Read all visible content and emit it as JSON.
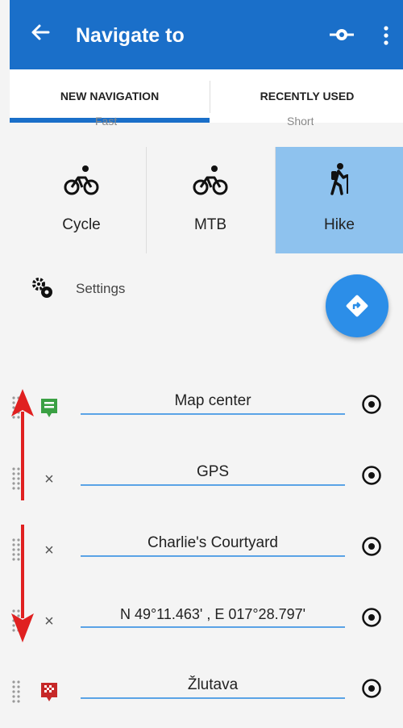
{
  "appbar": {
    "title": "Navigate to",
    "back_icon": "arrow-back-icon",
    "route_icon": "route-icon",
    "more_icon": "more-vert-icon"
  },
  "tabs": [
    {
      "label": "NEW NAVIGATION",
      "active": true
    },
    {
      "label": "RECENTLY USED",
      "active": false
    }
  ],
  "partial_tabs": {
    "left": "Fast",
    "right": "Short"
  },
  "modes": [
    {
      "label": "Cycle",
      "icon": "bicycle-icon",
      "selected": false
    },
    {
      "label": "MTB",
      "icon": "mtb-icon",
      "selected": false
    },
    {
      "label": "Hike",
      "icon": "hiker-icon",
      "selected": true
    }
  ],
  "settings": {
    "label": "Settings",
    "icon": "gears-icon"
  },
  "fab": {
    "icon": "directions-icon"
  },
  "waypoints": [
    {
      "value": "Map center",
      "lead": "start-flag-icon"
    },
    {
      "value": "GPS",
      "lead": "remove"
    },
    {
      "value": "Charlie's Courtyard",
      "lead": "remove"
    },
    {
      "value": "N 49°11.463' , E 017°28.797'",
      "lead": "remove"
    },
    {
      "value": "Žlutava",
      "lead": "finish-flag-icon"
    }
  ],
  "symbols": {
    "remove": "×"
  },
  "colors": {
    "primary": "#1a6fc9",
    "selected_mode": "#8ec2ee",
    "fab": "#2c8ee8",
    "annotation_arrow": "#e02020",
    "start": "#3aa043",
    "finish": "#c62828"
  }
}
